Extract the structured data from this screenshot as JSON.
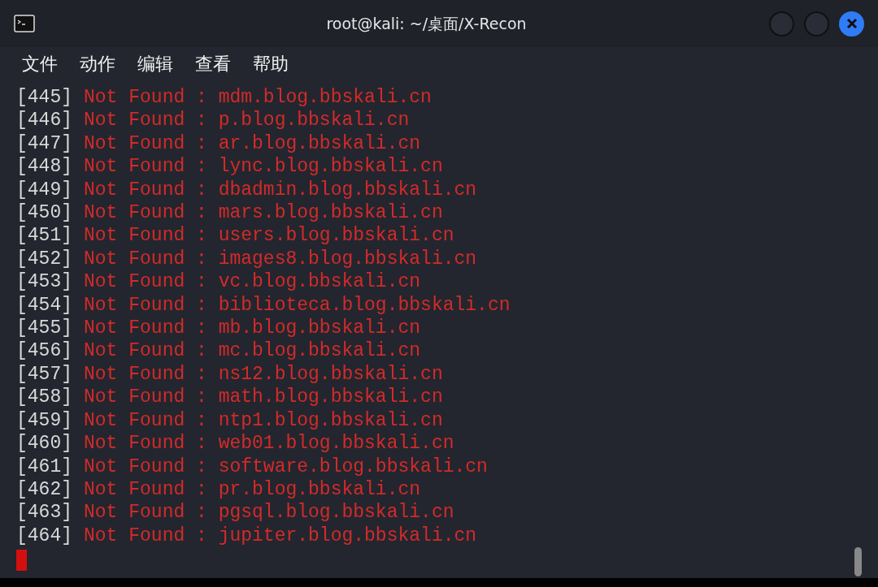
{
  "window": {
    "title": "root@kali: ~/桌面/X-Recon"
  },
  "menu": [
    "文件",
    "动作",
    "编辑",
    "查看",
    "帮助"
  ],
  "lines": [
    {
      "index": "[445]",
      "message": "Not Found : mdm.blog.bbskali.cn"
    },
    {
      "index": "[446]",
      "message": "Not Found : p.blog.bbskali.cn"
    },
    {
      "index": "[447]",
      "message": "Not Found : ar.blog.bbskali.cn"
    },
    {
      "index": "[448]",
      "message": "Not Found : lync.blog.bbskali.cn"
    },
    {
      "index": "[449]",
      "message": "Not Found : dbadmin.blog.bbskali.cn"
    },
    {
      "index": "[450]",
      "message": "Not Found : mars.blog.bbskali.cn"
    },
    {
      "index": "[451]",
      "message": "Not Found : users.blog.bbskali.cn"
    },
    {
      "index": "[452]",
      "message": "Not Found : images8.blog.bbskali.cn"
    },
    {
      "index": "[453]",
      "message": "Not Found : vc.blog.bbskali.cn"
    },
    {
      "index": "[454]",
      "message": "Not Found : biblioteca.blog.bbskali.cn"
    },
    {
      "index": "[455]",
      "message": "Not Found : mb.blog.bbskali.cn"
    },
    {
      "index": "[456]",
      "message": "Not Found : mc.blog.bbskali.cn"
    },
    {
      "index": "[457]",
      "message": "Not Found : ns12.blog.bbskali.cn"
    },
    {
      "index": "[458]",
      "message": "Not Found : math.blog.bbskali.cn"
    },
    {
      "index": "[459]",
      "message": "Not Found : ntp1.blog.bbskali.cn"
    },
    {
      "index": "[460]",
      "message": "Not Found : web01.blog.bbskali.cn"
    },
    {
      "index": "[461]",
      "message": "Not Found : software.blog.bbskali.cn"
    },
    {
      "index": "[462]",
      "message": "Not Found : pr.blog.bbskali.cn"
    },
    {
      "index": "[463]",
      "message": "Not Found : pgsql.blog.bbskali.cn"
    },
    {
      "index": "[464]",
      "message": "Not Found : jupiter.blog.bbskali.cn"
    }
  ]
}
